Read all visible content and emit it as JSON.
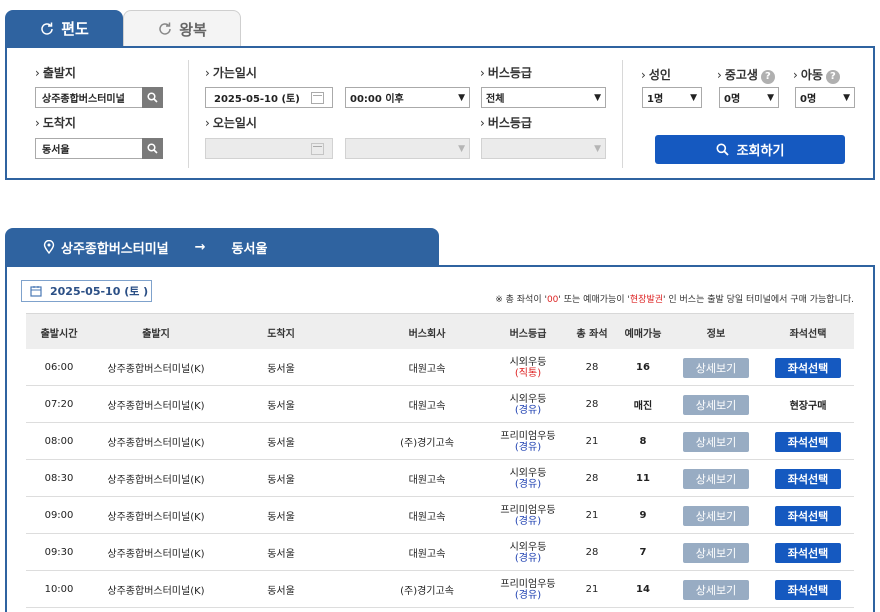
{
  "tabs": [
    {
      "label": "편도",
      "icon": "refresh-icon",
      "active": true
    },
    {
      "label": "왕복",
      "icon": "refresh-icon",
      "active": false
    }
  ],
  "search": {
    "departure_label": "출발지",
    "departure_value": "상주종합버스터미널",
    "arrival_label": "도착지",
    "arrival_value": "동서울",
    "go_date_label": "가는일시",
    "go_date_value": "2025-05-10 (토)",
    "go_time_value": "00:00 이후",
    "return_date_label": "오는일시",
    "bus_grade_label": "버스등급",
    "bus_grade_value": "전체",
    "bus_grade2_label": "버스등급",
    "adult_label": "성인",
    "adult_value": "1명",
    "student_label": "중고생",
    "student_value": "0명",
    "child_label": "아동",
    "child_value": "0명",
    "help_glyph": "?",
    "search_button": "조회하기"
  },
  "route": {
    "from": "상주종합버스터미널",
    "arrow": "→",
    "to": "동서울",
    "date_chip": "2025-05-10 (토 )"
  },
  "notice": {
    "prefix": "※ 총 좌석이 '",
    "zero": "00",
    "mid": "' 또는 예매가능이 '",
    "onsite": "현장발권",
    "suffix": "' 인 버스는 출발 당일 터미널에서 구매 가능합니다."
  },
  "table": {
    "headers": [
      "출발시간",
      "출발지",
      "도착지",
      "버스회사",
      "버스등급",
      "총 좌석",
      "예매가능",
      "정보",
      "좌석선택"
    ],
    "rows": [
      {
        "time": "06:00",
        "from": "상주종합버스터미널(K)",
        "to": "동서울",
        "company": "대원고속",
        "grade": "시외우등",
        "grade_sub": "(직통)",
        "sub_red": true,
        "seats": "28",
        "avail": "16",
        "detail": "상세보기",
        "action": "좌석선택",
        "action_button": true
      },
      {
        "time": "07:20",
        "from": "상주종합버스터미널(K)",
        "to": "동서울",
        "company": "대원고속",
        "grade": "시외우등",
        "grade_sub": "(경유)",
        "sub_red": false,
        "seats": "28",
        "avail": "매진",
        "detail": "상세보기",
        "action": "현장구매",
        "action_button": false
      },
      {
        "time": "08:00",
        "from": "상주종합버스터미널(K)",
        "to": "동서울",
        "company": "(주)경기고속",
        "grade": "프리미엄우등",
        "grade_sub": "(경유)",
        "sub_red": false,
        "seats": "21",
        "avail": "8",
        "detail": "상세보기",
        "action": "좌석선택",
        "action_button": true
      },
      {
        "time": "08:30",
        "from": "상주종합버스터미널(K)",
        "to": "동서울",
        "company": "대원고속",
        "grade": "시외우등",
        "grade_sub": "(경유)",
        "sub_red": false,
        "seats": "28",
        "avail": "11",
        "detail": "상세보기",
        "action": "좌석선택",
        "action_button": true
      },
      {
        "time": "09:00",
        "from": "상주종합버스터미널(K)",
        "to": "동서울",
        "company": "대원고속",
        "grade": "프리미엄우등",
        "grade_sub": "(경유)",
        "sub_red": false,
        "seats": "21",
        "avail": "9",
        "detail": "상세보기",
        "action": "좌석선택",
        "action_button": true
      },
      {
        "time": "09:30",
        "from": "상주종합버스터미널(K)",
        "to": "동서울",
        "company": "대원고속",
        "grade": "시외우등",
        "grade_sub": "(경유)",
        "sub_red": false,
        "seats": "28",
        "avail": "7",
        "detail": "상세보기",
        "action": "좌석선택",
        "action_button": true
      },
      {
        "time": "10:00",
        "from": "상주종합버스터미널(K)",
        "to": "동서울",
        "company": "(주)경기고속",
        "grade": "프리미엄우등",
        "grade_sub": "(경유)",
        "sub_red": false,
        "seats": "21",
        "avail": "14",
        "detail": "상세보기",
        "action": "좌석선택",
        "action_button": true
      }
    ]
  },
  "colors": {
    "primary": "#2f63a0",
    "button": "#1559c0",
    "detail_button": "#98acc3",
    "red": "#dd2222"
  }
}
